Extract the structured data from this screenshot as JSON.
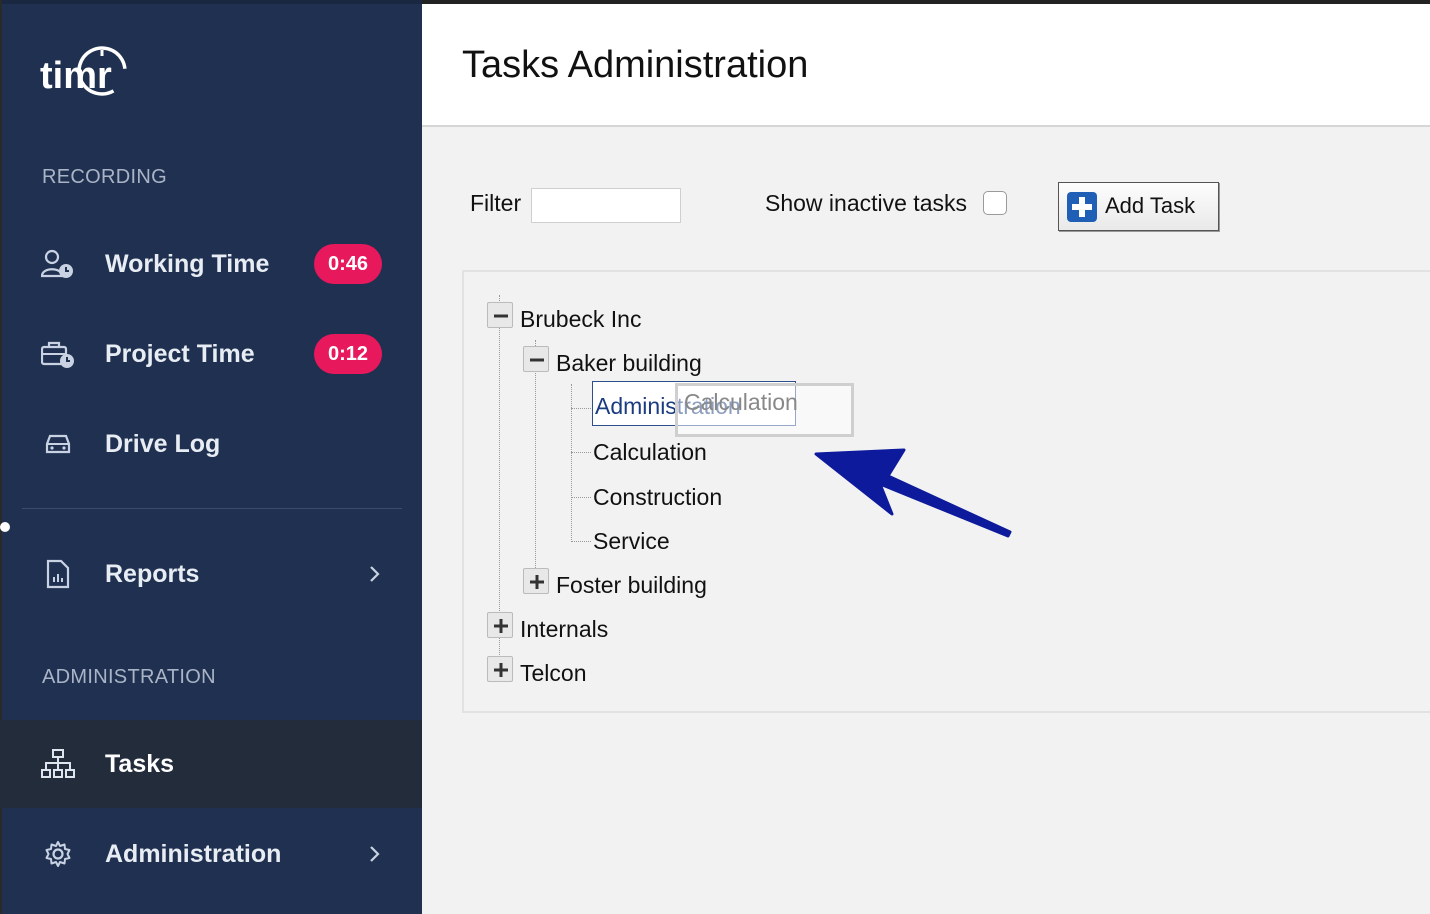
{
  "sidebar": {
    "brand": "timr",
    "sections": {
      "recording": "RECORDING",
      "administration": "ADMINISTRATION"
    },
    "items": {
      "working_time": {
        "label": "Working Time",
        "badge": "0:46"
      },
      "project_time": {
        "label": "Project Time",
        "badge": "0:12"
      },
      "drive_log": {
        "label": "Drive Log"
      },
      "reports": {
        "label": "Reports"
      },
      "tasks": {
        "label": "Tasks"
      },
      "administration": {
        "label": "Administration"
      }
    }
  },
  "main": {
    "title": "Tasks Administration",
    "filter_label": "Filter",
    "filter_value": "",
    "inactive_label": "Show inactive tasks",
    "add_task_label": "Add Task"
  },
  "tree": {
    "brubeck": "Brubeck Inc",
    "baker": "Baker building",
    "administration": "Administration",
    "calculation": "Calculation",
    "construction": "Construction",
    "service": "Service",
    "foster": "Foster building",
    "internals": "Internals",
    "telcon": "Telcon",
    "drag_label": "Calculation"
  },
  "colors": {
    "sidebar_bg": "#1f3050",
    "active_bg": "#232c3b",
    "badge": "#e8185c",
    "arrow": "#0d1a9c",
    "plus_icon": "#1f5fb5"
  }
}
